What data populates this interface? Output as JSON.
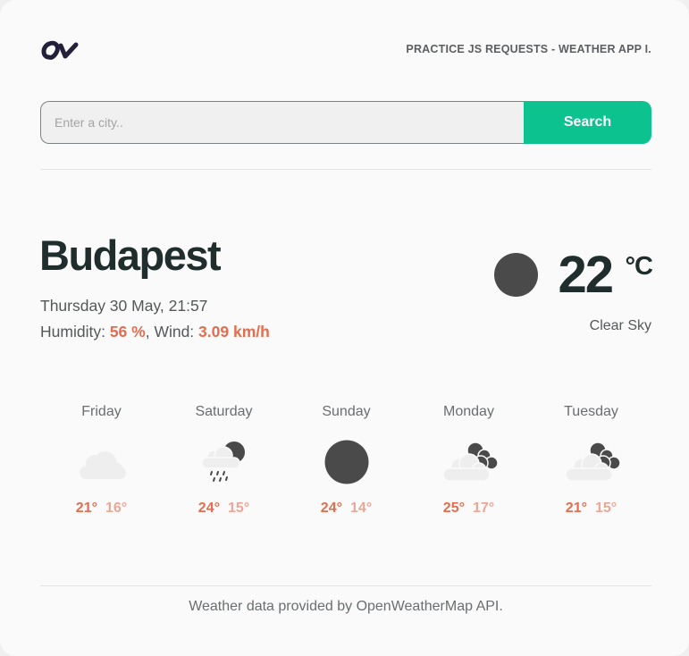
{
  "header": {
    "logo_icon": "ov-logo-icon",
    "title": "PRACTICE JS REQUESTS - WEATHER APP I."
  },
  "search": {
    "placeholder": "Enter a city..",
    "value": "",
    "button_label": "Search"
  },
  "current": {
    "city": "Budapest",
    "datetime": "Thursday 30 May, 21:57",
    "humidity_label": "Humidity:",
    "humidity_value": "56 %",
    "wind_label": "Wind:",
    "wind_value": "3.09 km/h",
    "temperature": "22",
    "unit": "°C",
    "condition": "Clear Sky",
    "icon": "moon-icon"
  },
  "forecast": [
    {
      "day": "Friday",
      "icon": "cloud-icon",
      "max": "21°",
      "min": "16°"
    },
    {
      "day": "Saturday",
      "icon": "rain-night-icon",
      "max": "24°",
      "min": "15°"
    },
    {
      "day": "Sunday",
      "icon": "moon-icon",
      "max": "24°",
      "min": "14°"
    },
    {
      "day": "Monday",
      "icon": "cloudy-night-icon",
      "max": "25°",
      "min": "17°"
    },
    {
      "day": "Tuesday",
      "icon": "cloudy-night-icon",
      "max": "21°",
      "min": "15°"
    }
  ],
  "footer": {
    "text": "Weather data provided by OpenWeatherMap API."
  },
  "colors": {
    "accent_green": "#0cc28f",
    "accent_orange": "#e36d4e",
    "min_temp": "#eca695",
    "heading": "#1f2d2c"
  }
}
